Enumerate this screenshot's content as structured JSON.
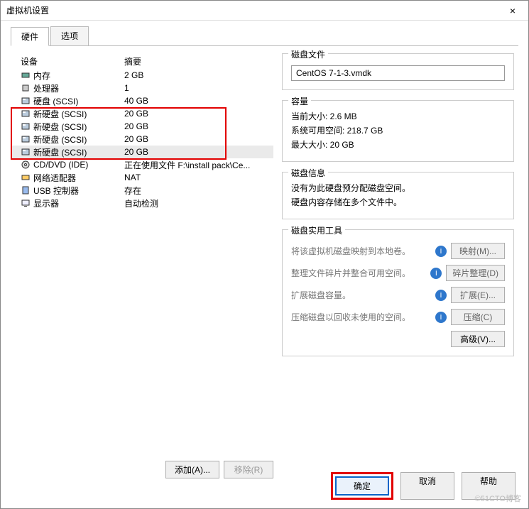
{
  "window": {
    "title": "虚拟机设置",
    "close": "×"
  },
  "tabs": {
    "hardware": "硬件",
    "options": "选项"
  },
  "headers": {
    "device": "设备",
    "summary": "摘要"
  },
  "devices": [
    {
      "name": "内存",
      "summary": "2 GB",
      "icon": "mem"
    },
    {
      "name": "处理器",
      "summary": "1",
      "icon": "cpu"
    },
    {
      "name": "硬盘 (SCSI)",
      "summary": "40 GB",
      "icon": "disk"
    },
    {
      "name": "新硬盘 (SCSI)",
      "summary": "20 GB",
      "icon": "disk"
    },
    {
      "name": "新硬盘 (SCSI)",
      "summary": "20 GB",
      "icon": "disk"
    },
    {
      "name": "新硬盘 (SCSI)",
      "summary": "20 GB",
      "icon": "disk"
    },
    {
      "name": "新硬盘 (SCSI)",
      "summary": "20 GB",
      "icon": "disk"
    },
    {
      "name": "CD/DVD (IDE)",
      "summary": "正在使用文件 F:\\install pack\\Ce...",
      "icon": "cd"
    },
    {
      "name": "网络适配器",
      "summary": "NAT",
      "icon": "net"
    },
    {
      "name": "USB 控制器",
      "summary": "存在",
      "icon": "usb"
    },
    {
      "name": "显示器",
      "summary": "自动检测",
      "icon": "display"
    }
  ],
  "leftButtons": {
    "add": "添加(A)...",
    "remove": "移除(R)"
  },
  "diskFile": {
    "title": "磁盘文件",
    "value": "CentOS 7-1-3.vmdk"
  },
  "capacity": {
    "title": "容量",
    "current": "当前大小: 2.6 MB",
    "free": "系统可用空间: 218.7 GB",
    "max": "最大大小: 20 GB"
  },
  "diskInfo": {
    "title": "磁盘信息",
    "line1": "没有为此硬盘预分配磁盘空间。",
    "line2": "硬盘内容存储在多个文件中。"
  },
  "tools": {
    "title": "磁盘实用工具",
    "mapText": "将该虚拟机磁盘映射到本地卷。",
    "mapBtn": "映射(M)...",
    "defragText": "整理文件碎片并整合可用空间。",
    "defragBtn": "碎片整理(D)",
    "expandText": "扩展磁盘容量。",
    "expandBtn": "扩展(E)...",
    "compactText": "压缩磁盘以回收未使用的空间。",
    "compactBtn": "压缩(C)",
    "advBtn": "高级(V)..."
  },
  "dialog": {
    "ok": "确定",
    "cancel": "取消",
    "help": "帮助"
  },
  "watermark": "©51CTO博客"
}
